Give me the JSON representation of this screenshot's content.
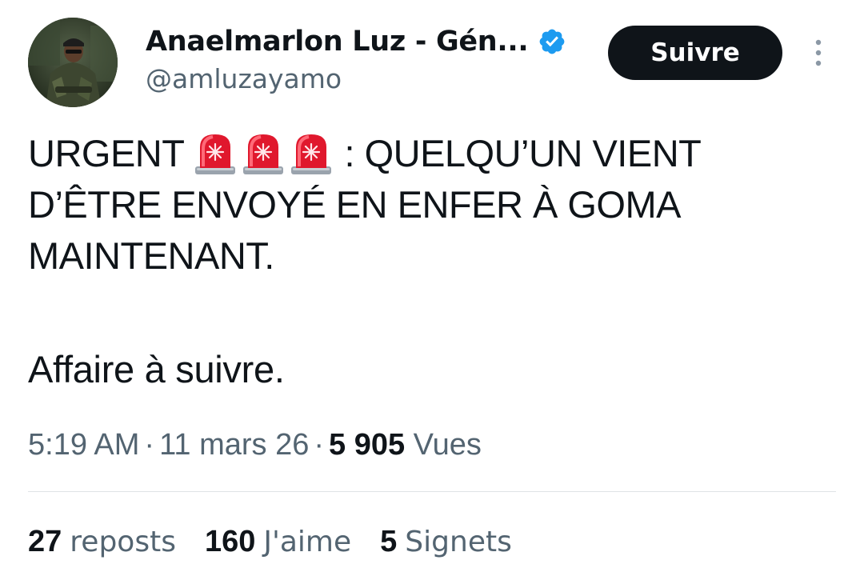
{
  "author": {
    "display_name": "Anaelmarlon Luz - Gén...",
    "handle": "@amluzayamo",
    "verified_icon": "verified-badge-icon",
    "avatar_icon": "profile-avatar"
  },
  "actions": {
    "follow_label": "Suivre",
    "more_icon": "more-options-icon"
  },
  "tweet": {
    "line1_start": "URGENT",
    "line1_end": ": QUELQU’UN VIENT",
    "line2": "D’ÊTRE ENVOYÉ EN ENFER À GOMA",
    "line3": "MAINTENANT.",
    "emoji_icon": "police-siren-icon",
    "emoji_count": 3,
    "followup": "Affaire à suivre."
  },
  "meta": {
    "time": "5:19 AM",
    "separator": "·",
    "date": "11 mars 26",
    "views_count": "5 905",
    "views_label": "Vues"
  },
  "stats": {
    "reposts_count": "27",
    "reposts_label": "reposts",
    "likes_count": "160",
    "likes_label": "J'aime",
    "bookmarks_count": "5",
    "bookmarks_label": "Signets"
  },
  "colors": {
    "text_primary": "#0f1419",
    "text_secondary": "#536471",
    "verified_blue": "#1d9bf0",
    "button_bg": "#0f1419",
    "siren_red": "#e0182d"
  }
}
